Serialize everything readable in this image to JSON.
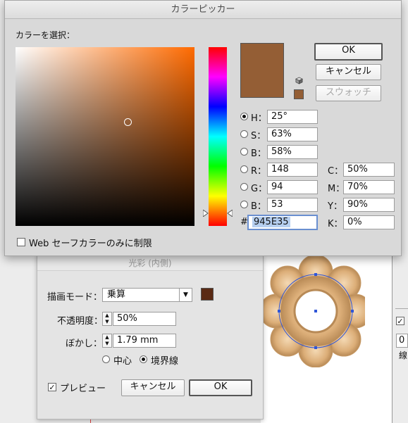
{
  "picker": {
    "title": "カラーピッカー",
    "select_label": "カラーを選択：",
    "ok_label": "OK",
    "cancel_label": "キャンセル",
    "swatch_label": "スウォッチ",
    "new_color": "#945E35",
    "hsb": [
      {
        "label": "H：",
        "value": "25°",
        "selected": true
      },
      {
        "label": "S：",
        "value": "63%",
        "selected": false
      },
      {
        "label": "B：",
        "value": "58%",
        "selected": false
      }
    ],
    "rgb": [
      {
        "label": "R：",
        "value": "148"
      },
      {
        "label": "G：",
        "value": "94"
      },
      {
        "label": "B：",
        "value": "53"
      }
    ],
    "cmyk": [
      {
        "label": "C：",
        "value": "50%"
      },
      {
        "label": "M：",
        "value": "70%"
      },
      {
        "label": "Y：",
        "value": "90%"
      },
      {
        "label": "K：",
        "value": "0%"
      }
    ],
    "hex_label": "#",
    "hex_value": "945E35",
    "web_safe_label": "Web セーフカラーのみに制限",
    "hue_level": 0.93,
    "sat_level": 0.63,
    "bri_level": 0.58
  },
  "glow": {
    "title": "光彩 (内側)",
    "mode_label": "描画モード：",
    "mode_value": "乗算",
    "opacity_label": "不透明度：",
    "opacity_value": "50%",
    "blur_label": "ぼかし：",
    "blur_value": "1.79 mm",
    "center_label": "中心",
    "edge_label": "境界線",
    "preview_label": "プレビュー",
    "cancel_label": "キャンセル",
    "ok_label": "OK",
    "swatch_color": "#5a2a14"
  },
  "side": {
    "field_value": "0",
    "label": "線"
  }
}
